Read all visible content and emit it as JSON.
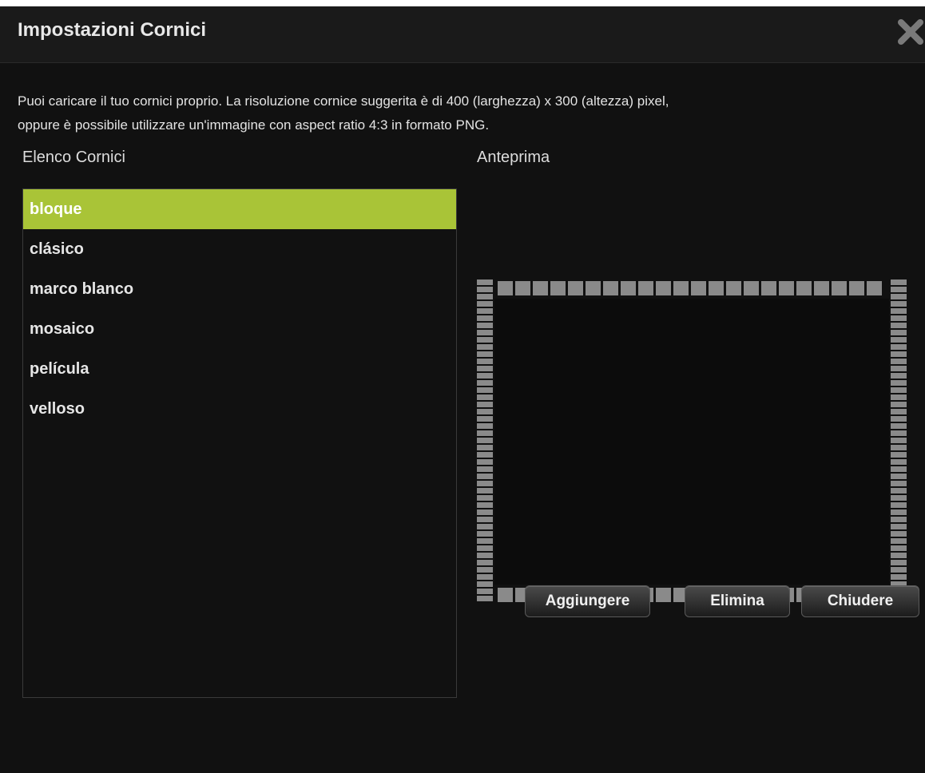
{
  "dialog": {
    "title": "Impostazioni Cornici",
    "close_icon": "close-x-icon"
  },
  "description": {
    "line1": "Puoi caricare il tuo cornici proprio. La risoluzione cornice suggerita è di 400 (larghezza) x 300 (altezza) pixel,",
    "line2": "oppure è possibile utilizzare un'immagine con aspect ratio 4:3 in formato PNG."
  },
  "list": {
    "heading": "Elenco Cornici",
    "items": [
      {
        "label": "bloque",
        "selected": true
      },
      {
        "label": "clásico",
        "selected": false
      },
      {
        "label": "marco blanco",
        "selected": false
      },
      {
        "label": "mosaico",
        "selected": false
      },
      {
        "label": "película",
        "selected": false
      },
      {
        "label": "velloso",
        "selected": false
      }
    ]
  },
  "preview": {
    "heading": "Anteprima"
  },
  "buttons": {
    "add": "Aggiungere",
    "delete": "Elimina",
    "close": "Chiudere"
  },
  "colors": {
    "background": "#111111",
    "selected": "#a9c437",
    "frame_block": "#8a8a8a"
  }
}
